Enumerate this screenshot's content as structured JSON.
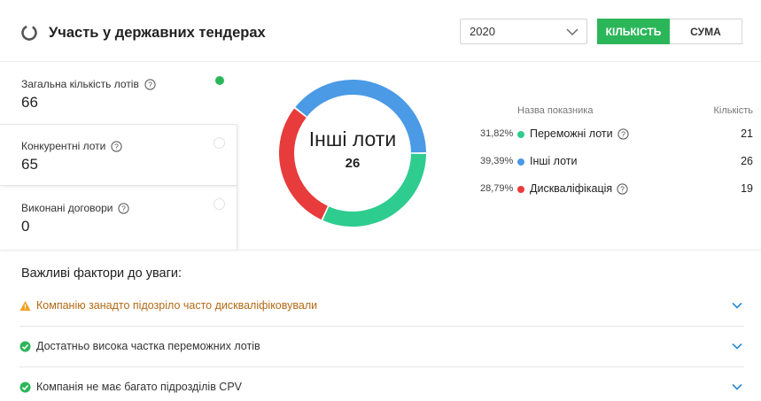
{
  "header": {
    "title": "Участь у державних тендерах",
    "year": "2020",
    "toggle_count": "КІЛЬКІСТЬ",
    "toggle_sum": "СУМА"
  },
  "stats": [
    {
      "label": "Загальна кількість лотів",
      "value": "66",
      "dot_color": "#2cb65a"
    },
    {
      "label": "Конкурентні лоти",
      "value": "65",
      "dot_color": "#ffffff"
    },
    {
      "label": "Виконані договори",
      "value": "0",
      "dot_color": "#ffffff"
    }
  ],
  "donut": {
    "center_title": "Інші лоти",
    "center_value": "26"
  },
  "legend": {
    "header_name": "Назва показника",
    "header_count": "Кількість"
  },
  "chart_data": {
    "type": "pie",
    "series": [
      {
        "name": "Переможні лоти",
        "value": 21,
        "percent": "31,82%",
        "color": "#2ecc8f",
        "has_help": true
      },
      {
        "name": "Інші лоти",
        "value": 26,
        "percent": "39,39%",
        "color": "#4a9ae6",
        "has_help": false
      },
      {
        "name": "Дискваліфікація",
        "value": 19,
        "percent": "28,79%",
        "color": "#e83b3b",
        "has_help": true
      }
    ]
  },
  "factors": {
    "title": "Важливі фактори до уваги:",
    "items": [
      {
        "text": "Компанію занадто підозріло часто дискваліфіковували",
        "type": "warning",
        "color": "#b36a16"
      },
      {
        "text": "Достатньо висока частка переможних лотів",
        "type": "ok",
        "color": "#333333"
      },
      {
        "text": "Компанія не має багато підрозділів CPV",
        "type": "ok",
        "color": "#333333"
      }
    ]
  },
  "colors": {
    "accent_green": "#2cb65a",
    "warning_orange": "#f0a020",
    "ok_green": "#2cb65a",
    "chevron_blue": "#2a8ad6"
  }
}
